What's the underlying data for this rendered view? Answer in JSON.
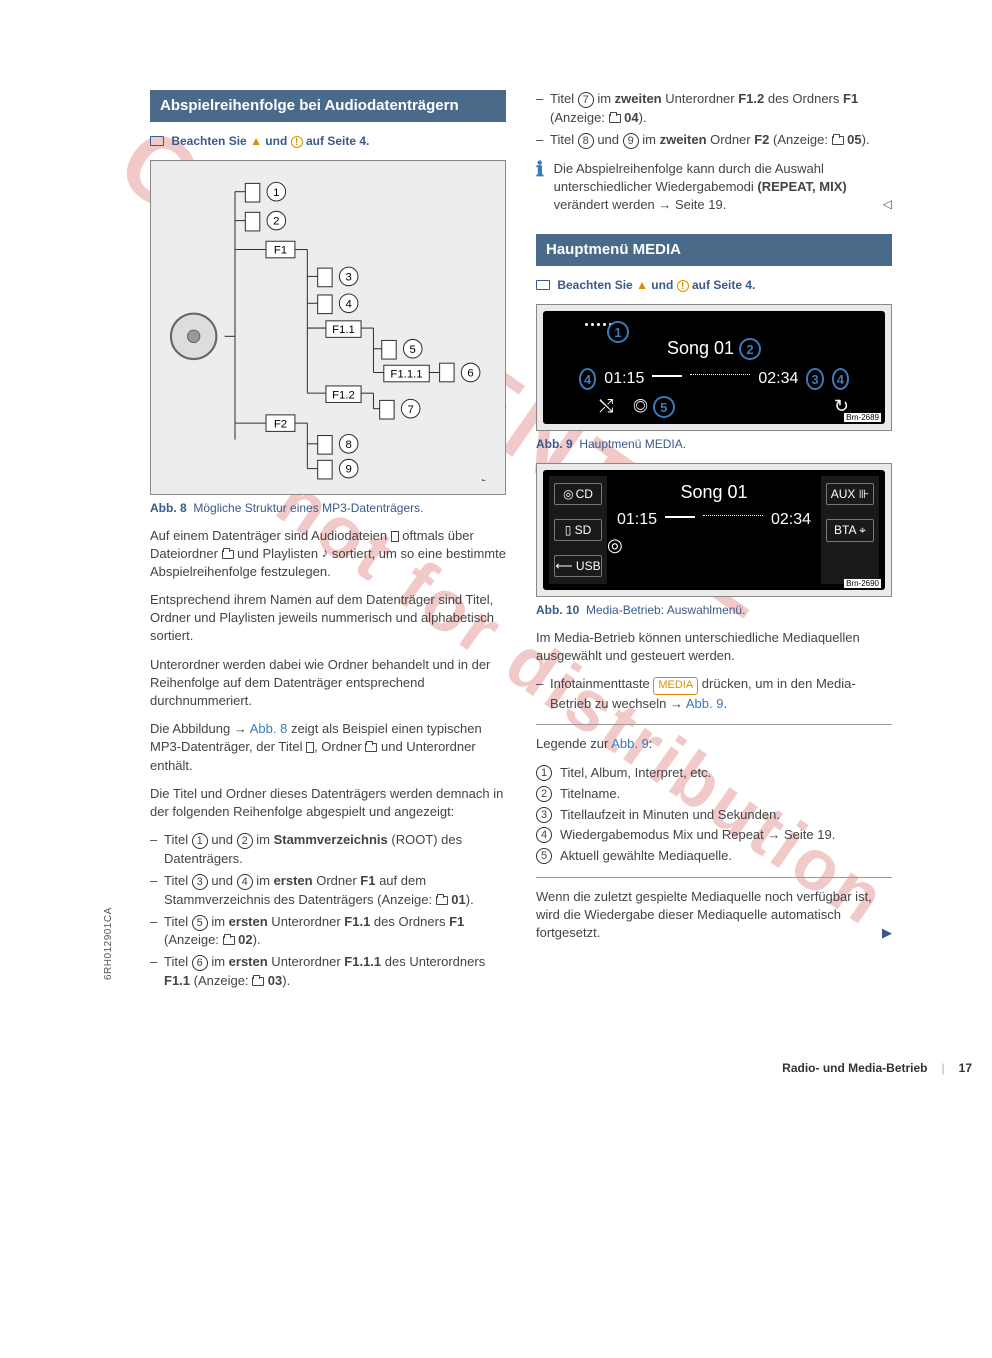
{
  "watermarks": {
    "wm1": "CONFIDENTIAL",
    "wm2": "not for distribution"
  },
  "side_code": "6RH012901CA",
  "left": {
    "heading": "Abspielreihenfolge bei Audiodatenträgern",
    "note": {
      "prefix": "Beachten Sie",
      "suffix": "auf Seite 4.",
      "und": "und"
    },
    "fig8_caption_bold": "Abb. 8",
    "fig8_caption": "Mögliche Struktur eines MP3-Datenträgers.",
    "p1": "Auf einem Datenträger sind Audiodateien ",
    "p1b": " oftmals über Dateiordner ",
    "p1c": " und Playlisten ",
    "p1d": " sortiert, um so eine bestimmte Abspielreihenfolge festzulegen.",
    "p2": "Entsprechend ihrem Namen auf dem Datenträger sind Titel, Ordner und Playlisten jeweils nummerisch und alphabetisch sortiert.",
    "p3": "Unterordner werden dabei wie Ordner behandelt und in der Reihenfolge auf dem Datenträger entsprechend durchnummeriert.",
    "p4a": "Die Abbildung → ",
    "p4link": "Abb. 8",
    "p4b": " zeigt als Beispiel einen typischen MP3-Datenträger, der Titel ",
    "p4c": ", Ordner ",
    "p4d": " und Unterordner enthält.",
    "p5": "Die Titel und Ordner dieses Datenträgers werden demnach in der folgenden Reihenfolge abgespielt und angezeigt:",
    "items": [
      {
        "pre": "Titel ",
        "nums": [
          "1",
          "2"
        ],
        "mid": " und ",
        "post": " im ",
        "bold": "Stammverzeichnis",
        "tail": " (ROOT) des Datenträgers."
      },
      {
        "pre": "Titel ",
        "nums": [
          "3",
          "4"
        ],
        "mid": " und ",
        "post": " im ",
        "bold": "ersten",
        "tail_html": " Ordner <b>F1</b> auf dem Stammverzeichnis des Datenträgers (Anzeige: ",
        "folder_label": "01",
        "close": ")."
      },
      {
        "pre": "Titel ",
        "nums": [
          "5"
        ],
        "post": " im ",
        "bold": "ersten",
        "tail_html": " Unterordner <b>F1.1</b> des Ordners <b>F1</b> (Anzeige: ",
        "folder_label": "02",
        "close": ")."
      },
      {
        "pre": "Titel ",
        "nums": [
          "6"
        ],
        "post": " im ",
        "bold": "ersten",
        "tail_html": " Unterordner <b>F1.1.1</b> des Unterordners <b>F1.1</b> (Anzeige: ",
        "folder_label": "03",
        "close": ")."
      }
    ],
    "tree_labels": {
      "f1": "F1",
      "f11": "F1.1",
      "f111": "F1.1.1",
      "f12": "F1.2",
      "f2": "F2"
    },
    "tree_code": "Brn-1257"
  },
  "right": {
    "top_items": [
      {
        "pre": "Titel ",
        "nums": [
          "7"
        ],
        "post": " im ",
        "bold": "zweiten",
        "tail_html": " Unterordner <b>F1.2</b> des Ordners <b>F1</b> (Anzeige: ",
        "folder_label": "04",
        "close": ")."
      },
      {
        "pre": "Titel ",
        "nums": [
          "8",
          "9"
        ],
        "mid": " und ",
        "post": " im ",
        "bold": "zweiten",
        "tail_html": " Ordner <b>F2</b> (Anzeige: ",
        "folder_label": "05",
        "close": ")."
      }
    ],
    "info_a": "Die Abspielreihenfolge kann durch die Auswahl unterschiedlicher Wiedergabemodi ",
    "info_b": "(REPEAT, MIX)",
    "info_c": " verändert werden → Seite 19.",
    "heading": "Hauptmenü MEDIA",
    "note": {
      "prefix": "Beachten Sie",
      "suffix": "auf Seite 4.",
      "und": "und"
    },
    "screen1": {
      "title": "Song 01",
      "t1": "01:15",
      "t2": "02:34",
      "code": "Brn-2689"
    },
    "fig9_caption_bold": "Abb. 9",
    "fig9_caption": "Hauptmenü MEDIA.",
    "screen2": {
      "left": [
        "CD",
        "SD",
        "USB"
      ],
      "right": [
        "AUX",
        "BTA"
      ],
      "title": "Song 01",
      "t1": "01:15",
      "t2": "02:34",
      "code": "Brn-2690"
    },
    "fig10_caption_bold": "Abb. 10",
    "fig10_caption": "Media-Betrieb: Auswahlmenü.",
    "p_media": "Im Media-Betrieb können unterschiedliche Mediaquellen ausgewählt und gesteuert werden.",
    "p_key_a": "Infotainmenttaste ",
    "key": "MEDIA",
    "p_key_b": " drücken, um in den Media-Betrieb zu wechseln → ",
    "p_key_link": "Abb. 9",
    "legend_title_a": "Legende zur ",
    "legend_title_link": "Abb. 9",
    "legend": [
      "Titel, Album, Interpret, etc.",
      "Titelname.",
      "Titellaufzeit in Minuten und Sekunden.",
      "Wiedergabemodus Mix und Repeat → Seite 19.",
      "Aktuell gewählte Mediaquelle."
    ],
    "p_last": "Wenn die zuletzt gespielte Mediaquelle noch verfügbar ist, wird die Wiedergabe dieser Mediaquelle automatisch fortgesetzt."
  },
  "footer": {
    "title": "Radio- und Media-Betrieb",
    "page": "17"
  }
}
